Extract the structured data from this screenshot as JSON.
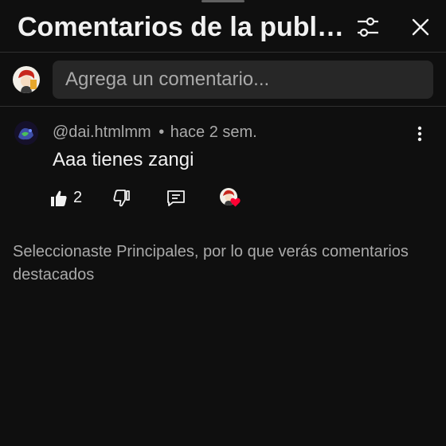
{
  "header": {
    "title": "Comentarios de la publicación",
    "filter_icon": "sliders-icon",
    "close_icon": "close-icon"
  },
  "composer": {
    "placeholder": "Agrega un comentario..."
  },
  "comments": [
    {
      "author": "@dai.htmlmm",
      "separator": "•",
      "time": "hace 2 sem.",
      "text": "Aaa tienes zangi",
      "likes": "2"
    }
  ],
  "notice": "Seleccionaste Principales, por lo que verás comentarios destacados",
  "colors": {
    "background": "#0f0f0f",
    "text_primary": "#f1f1f1",
    "text_secondary": "#aaaaaa",
    "input_bg": "#272727",
    "heart": "#ff0033"
  }
}
